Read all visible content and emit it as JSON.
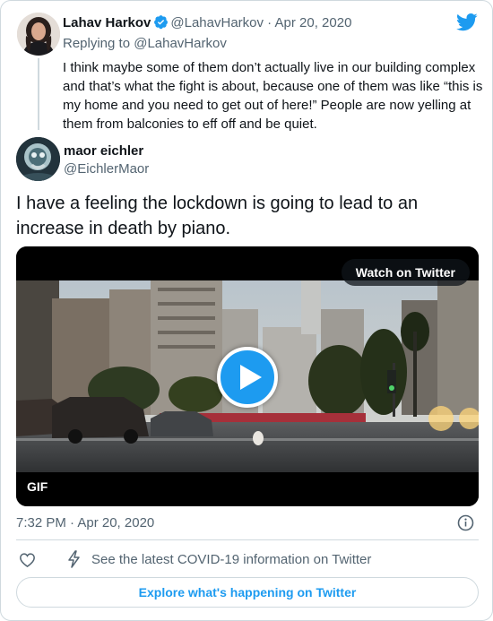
{
  "parent_tweet": {
    "author_name": "Lahav Harkov",
    "author_handle": "@LahavHarkov",
    "separator": " · ",
    "date": "Apr 20, 2020",
    "replying_to": "Replying to @LahavHarkov",
    "text": "I think maybe some of them don’t actually live in our building complex and that’s what the fight is about, because one of them was like “this is my home and you need to get out of here!” People are now yelling at them from balconies to eff off and be quiet."
  },
  "main_tweet": {
    "author_name": "maor eichler",
    "author_handle": "@EichlerMaor",
    "text": "I have a feeling the lockdown is going to lead to an increase in death by piano.",
    "media": {
      "watch_label": "Watch on Twitter",
      "badge": "GIF"
    },
    "timestamp": "7:32 PM · Apr 20, 2020"
  },
  "footer": {
    "covid_info": "See the latest COVID-19 information on Twitter",
    "explore_label": "Explore what's happening on Twitter"
  },
  "colors": {
    "brand_blue": "#1d9bf0",
    "text_primary": "#0f1419",
    "text_secondary": "#536471",
    "border": "#cfd9de"
  },
  "icons": [
    "twitter-logo-icon",
    "verified-badge-icon",
    "play-icon",
    "info-icon",
    "heart-icon",
    "lightning-bolt-icon"
  ]
}
